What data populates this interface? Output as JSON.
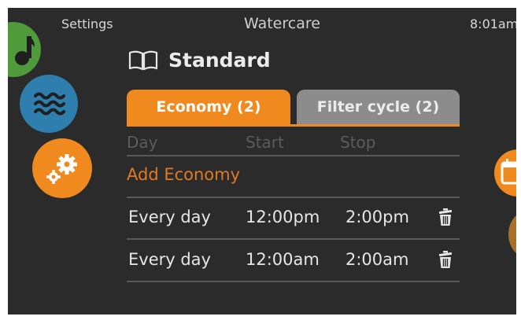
{
  "header": {
    "left_label": "Settings",
    "title": "Watercare",
    "time": "8:01am"
  },
  "page": {
    "heading": "Standard",
    "heading_icon": "book-icon"
  },
  "tabs": [
    {
      "label": "Economy (2)",
      "active": true
    },
    {
      "label": "Filter cycle (2)",
      "active": false
    }
  ],
  "table": {
    "columns": [
      "Day",
      "Start",
      "Stop"
    ],
    "add_label": "Add Economy",
    "rows": [
      {
        "day": "Every day",
        "start": "12:00pm",
        "stop": "2:00pm"
      },
      {
        "day": "Every day",
        "start": "12:00am",
        "stop": "2:00am"
      }
    ]
  },
  "side_icons": {
    "left": [
      "music-note-icon",
      "waves-icon",
      "gears-icon"
    ],
    "right": [
      "calendar-icon",
      "unknown-icon"
    ]
  },
  "colors": {
    "background": "#2b2b2b",
    "accent_orange": "#f08a1f",
    "green": "#4f9a3a",
    "blue": "#2e7fae",
    "tab_inactive": "#8c8c8c"
  }
}
